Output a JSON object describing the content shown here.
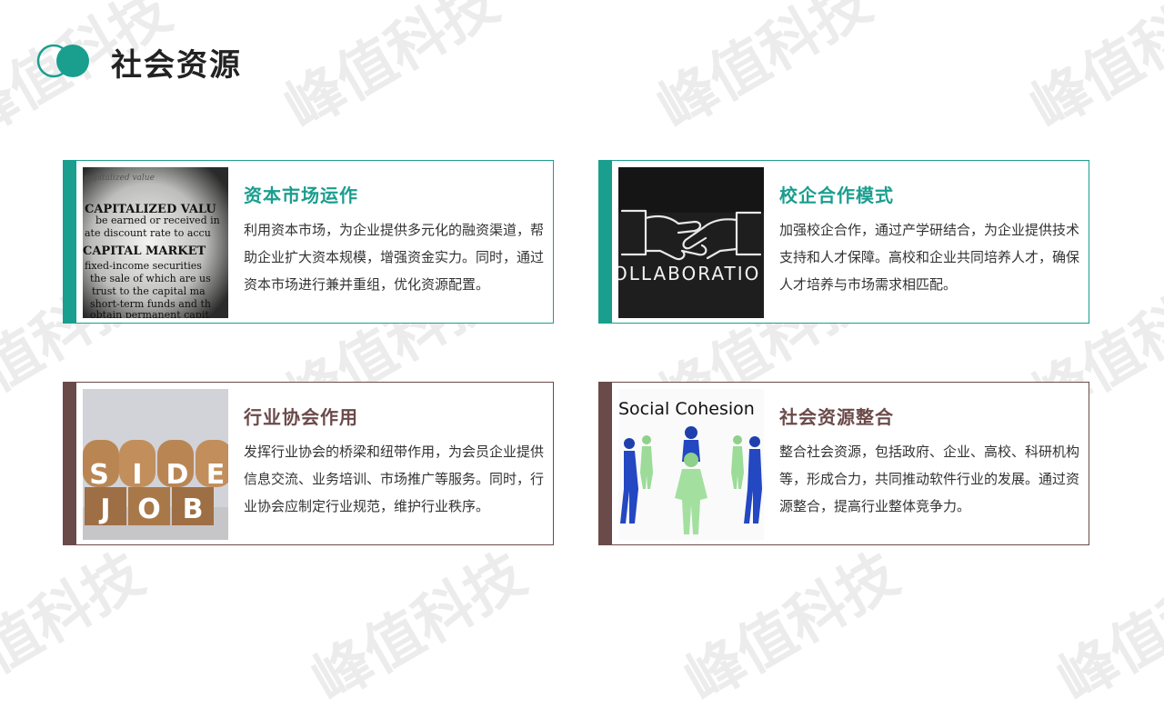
{
  "page": {
    "title": "社会资源",
    "watermark": "峰值科技",
    "accent_teal": "#1a9e8e",
    "accent_brown": "#6b4a4a"
  },
  "cards": [
    {
      "title": "资本市场运作",
      "body": "利用资本市场，为企业提供多元化的融资渠道，帮助企业扩大资本规模，增强资金实力。同时，通过资本市场进行兼并重组，优化资源配置。",
      "image_icon": "capital-market-text-photo",
      "image_text": [
        "capitalized value",
        "CAPITALIZED VALU",
        "be earned or received in",
        "ate discount rate to accu",
        "CAPITAL MARKET",
        "fixed-income securities",
        "the sale of which are us",
        "trust to the capital ma",
        "short-term funds and th",
        "obtain permanent capit"
      ]
    },
    {
      "title": "校企合作模式",
      "body": "加强校企合作，通过产学研结合，为企业提供技术支持和人才保障。高校和企业共同培养人才，确保人才培养与市场需求相匹配。",
      "image_icon": "handshake-chalkboard-photo",
      "image_text": "OLLABORATIO"
    },
    {
      "title": "行业协会作用",
      "body": "发挥行业协会的桥梁和纽带作用，为会员企业提供信息交流、业务培训、市场推广等服务。同时，行业协会应制定行业规范，维护行业秩序。",
      "image_icon": "side-job-blocks-photo",
      "image_text": {
        "top": [
          "S",
          "I",
          "D",
          "E"
        ],
        "bottom": [
          "J",
          "O",
          "B"
        ]
      }
    },
    {
      "title": "社会资源整合",
      "body": "整合社会资源，包括政府、企业、高校、科研机构等，形成合力，共同推动软件行业的发展。通过资源整合，提高行业整体竞争力。",
      "image_icon": "social-cohesion-figures-photo",
      "image_text": "Social Cohesion"
    }
  ]
}
